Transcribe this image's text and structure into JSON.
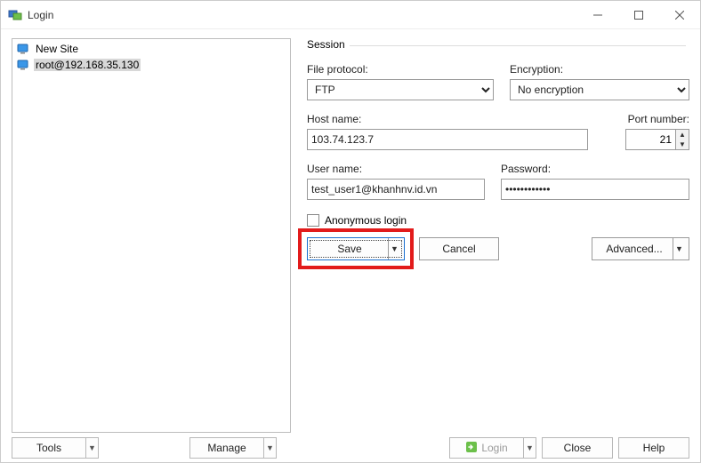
{
  "window": {
    "title": "Login"
  },
  "sites": [
    {
      "label": "New Site",
      "selected": false,
      "icon": "site"
    },
    {
      "label": "root@192.168.35.130",
      "selected": true,
      "icon": "computer"
    }
  ],
  "session": {
    "group_label": "Session",
    "file_protocol_label": "File protocol:",
    "file_protocol_value": "FTP",
    "encryption_label": "Encryption:",
    "encryption_value": "No encryption",
    "host_label": "Host name:",
    "host_value": "103.74.123.7",
    "port_label": "Port number:",
    "port_value": "21",
    "user_label": "User name:",
    "user_value": "test_user1@khanhnv.id.vn",
    "password_label": "Password:",
    "password_value": "••••••••••••",
    "anon_label": "Anonymous login",
    "save_label": "Save",
    "cancel_label": "Cancel",
    "advanced_label": "Advanced..."
  },
  "footer": {
    "tools_label": "Tools",
    "manage_label": "Manage",
    "login_label": "Login",
    "close_label": "Close",
    "help_label": "Help"
  }
}
